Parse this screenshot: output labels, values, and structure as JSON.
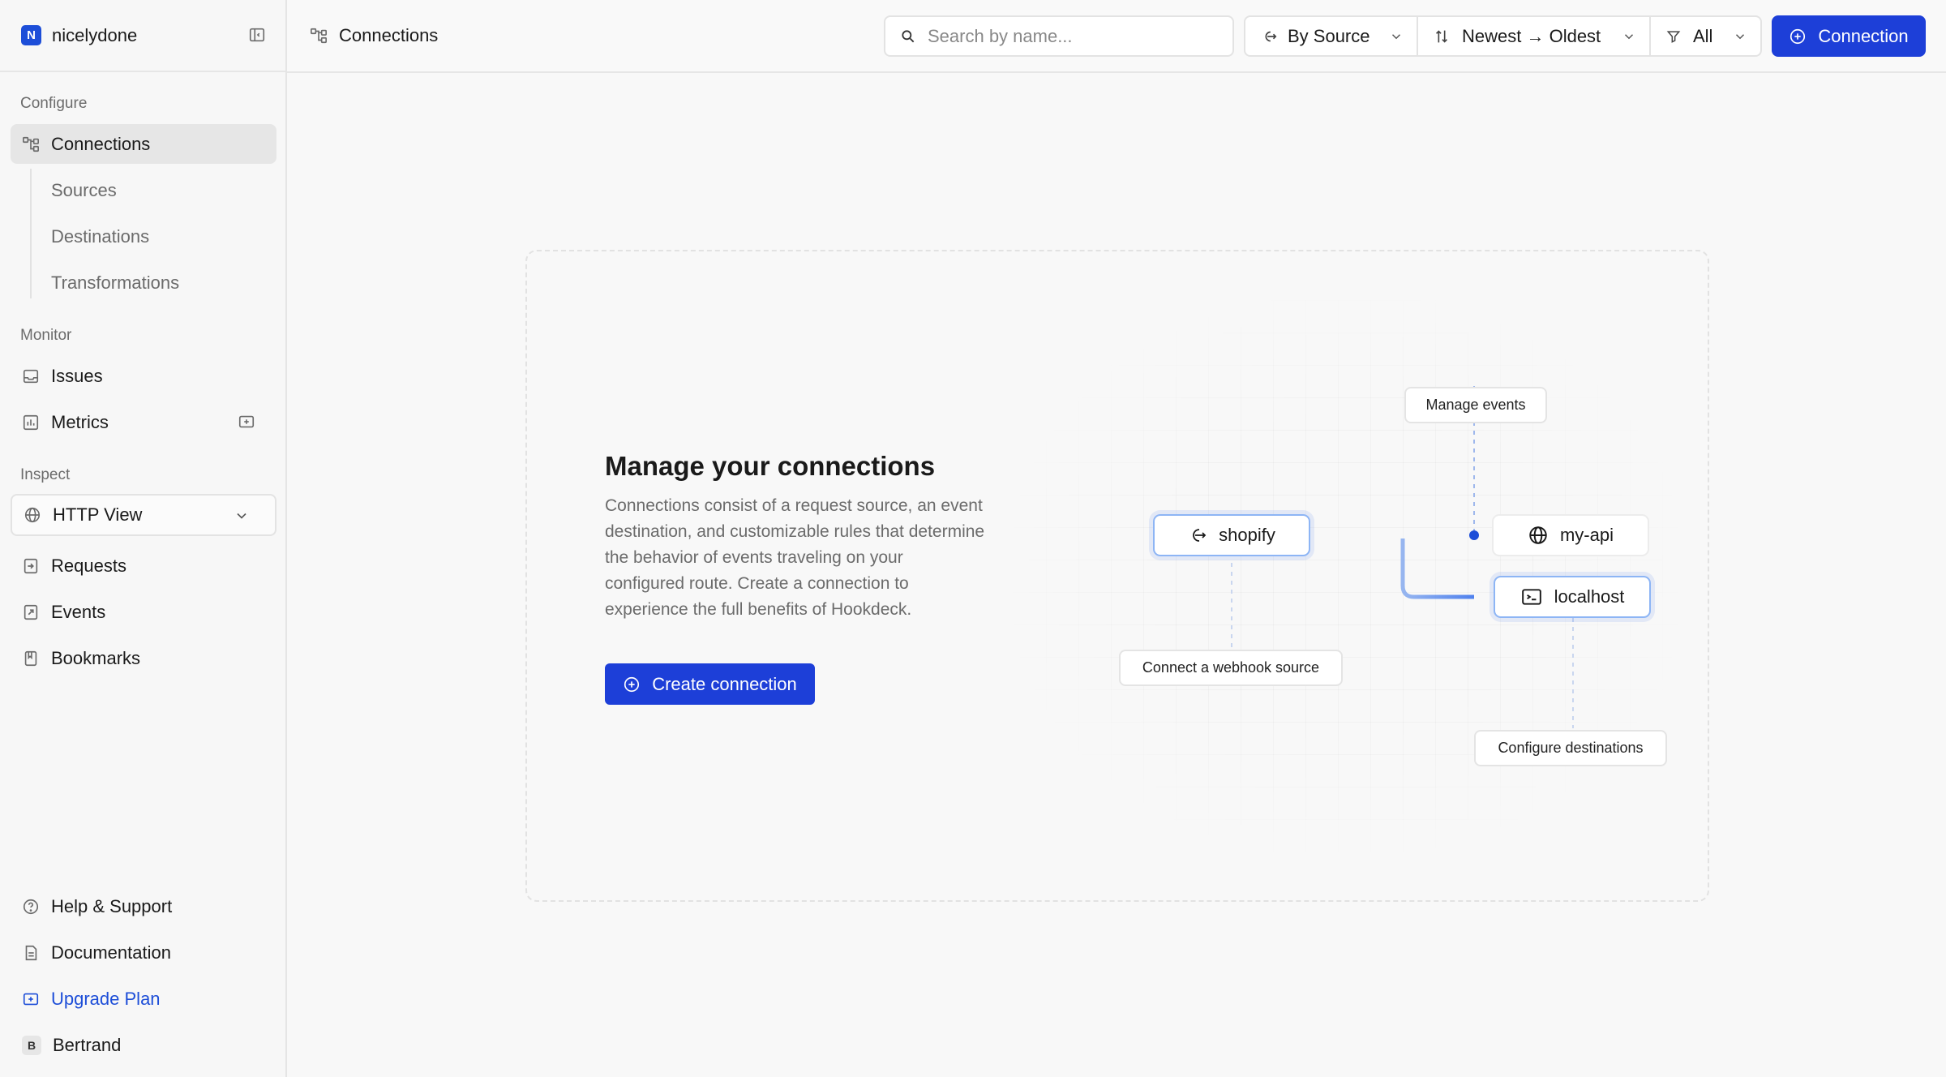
{
  "workspace": {
    "badge": "N",
    "name": "nicelydone"
  },
  "sidebar": {
    "configure_label": "Configure",
    "connections": "Connections",
    "sources": "Sources",
    "destinations": "Destinations",
    "transformations": "Transformations",
    "monitor_label": "Monitor",
    "issues": "Issues",
    "metrics": "Metrics",
    "inspect_label": "Inspect",
    "view_selector": "HTTP View",
    "requests": "Requests",
    "events": "Events",
    "bookmarks": "Bookmarks",
    "help": "Help & Support",
    "documentation": "Documentation",
    "upgrade": "Upgrade Plan",
    "user_initial": "B",
    "user_name": "Bertrand"
  },
  "header": {
    "breadcrumb": "Connections",
    "search_placeholder": "Search by name...",
    "group_by": "By Source",
    "sort": "Newest → Oldest",
    "filter": "All",
    "add_button": "Connection"
  },
  "empty_state": {
    "title": "Manage your connections",
    "description": "Connections consist of a request source, an event destination, and customizable rules that determine the behavior of events traveling on your configured route. Create a connection to experience the full benefits of Hookdeck.",
    "button": "Create connection"
  },
  "diagram": {
    "source_node": "shopify",
    "dest_node_1": "my-api",
    "dest_node_2": "localhost",
    "label_manage": "Manage events",
    "label_source": "Connect a webhook source",
    "label_destinations": "Configure destinations"
  },
  "colors": {
    "accent": "#1d3fd8",
    "brand_badge": "#1d4ed8",
    "highlight_border": "#8db5f5"
  },
  "icons": [
    "collapse-sidebar-icon",
    "connections-icon",
    "inbox-icon",
    "metrics-icon",
    "plus-box-icon",
    "globe-icon",
    "chevron-down-icon",
    "request-icon",
    "events-icon",
    "bookmark-icon",
    "help-icon",
    "document-icon",
    "search-icon",
    "group-icon",
    "sort-icon",
    "filter-icon",
    "plus-circle-icon",
    "source-arrow-icon",
    "terminal-icon"
  ]
}
